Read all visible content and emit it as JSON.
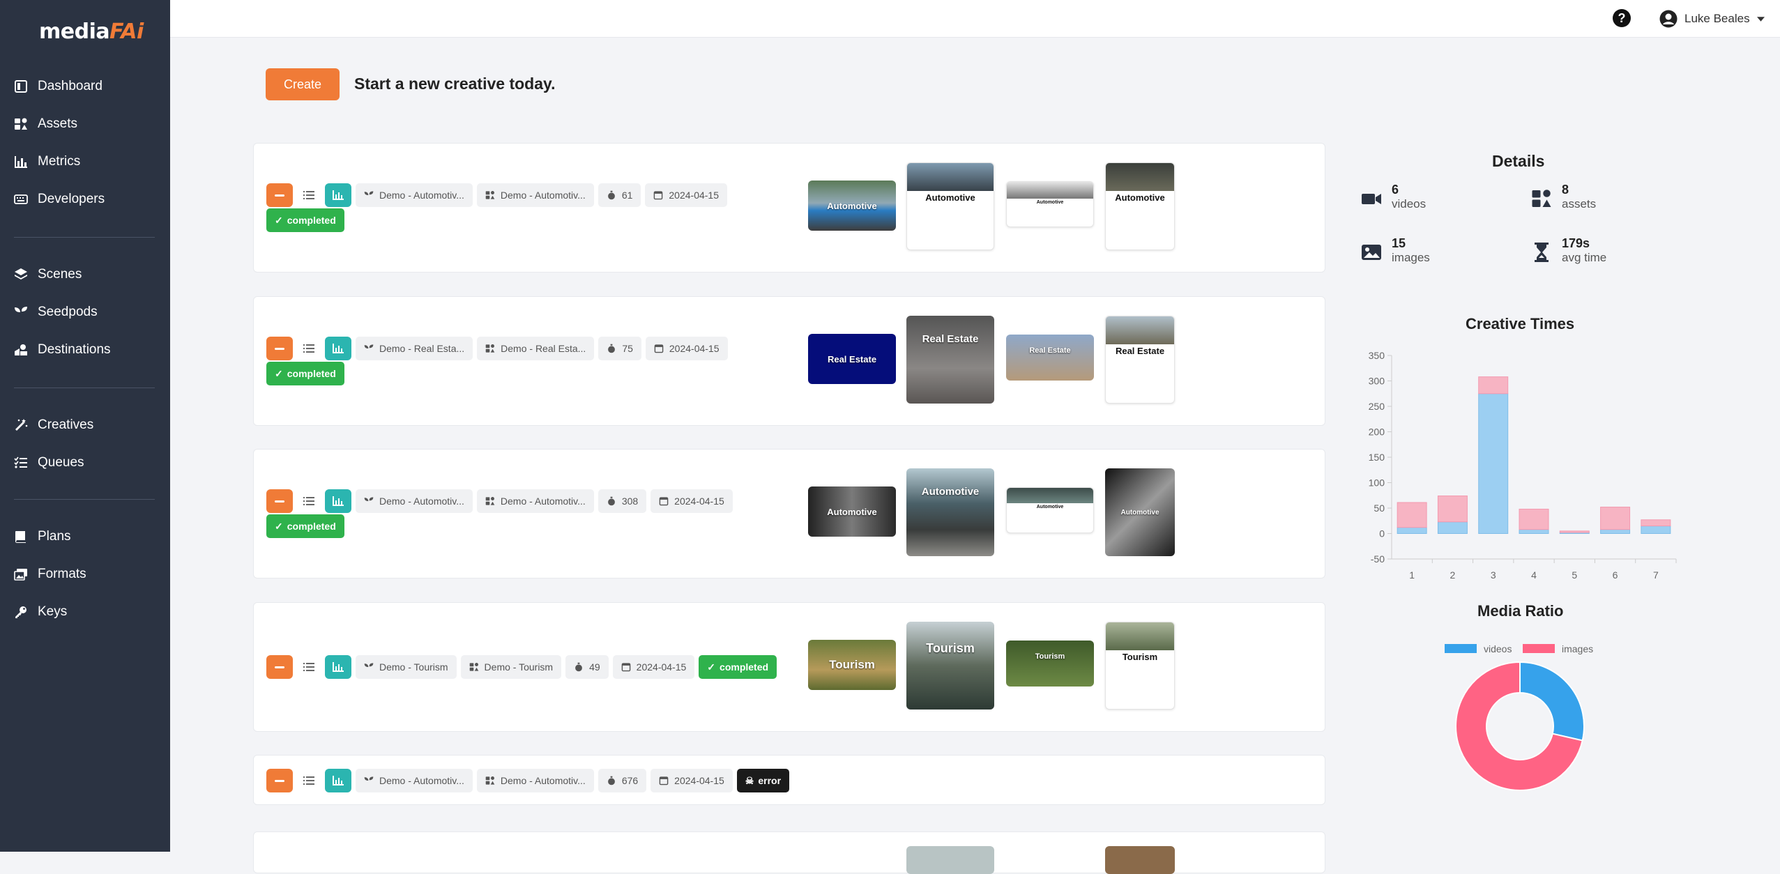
{
  "app": {
    "logo_main": "media",
    "logo_accent": "FAi"
  },
  "sidebar": {
    "items": [
      {
        "label": "Dashboard",
        "icon": "dashboard-icon"
      },
      {
        "label": "Assets",
        "icon": "assets-icon"
      },
      {
        "label": "Metrics",
        "icon": "metrics-icon"
      },
      {
        "label": "Developers",
        "icon": "keyboard-icon"
      },
      {
        "label": "Scenes",
        "icon": "layers-icon"
      },
      {
        "label": "Seedpods",
        "icon": "seedling-icon"
      },
      {
        "label": "Destinations",
        "icon": "destinations-icon"
      },
      {
        "label": "Creatives",
        "icon": "magic-wand-icon"
      },
      {
        "label": "Queues",
        "icon": "list-check-icon"
      },
      {
        "label": "Plans",
        "icon": "book-icon"
      },
      {
        "label": "Formats",
        "icon": "formats-icon"
      },
      {
        "label": "Keys",
        "icon": "key-icon"
      }
    ]
  },
  "topbar": {
    "user_name": "Luke Beales"
  },
  "create": {
    "button_label": "Create",
    "tagline": "Start a new creative today."
  },
  "creatives": [
    {
      "seedpod": "Demo - Automotiv...",
      "scene": "Demo - Automotiv...",
      "time": "61",
      "date": "2024-04-15",
      "status": "completed",
      "thumbs": [
        "Automotive",
        "Automotive",
        "Automotive",
        "Automotive"
      ]
    },
    {
      "seedpod": "Demo - Real Esta...",
      "scene": "Demo - Real Esta...",
      "time": "75",
      "date": "2024-04-15",
      "status": "completed",
      "thumbs": [
        "Real Estate",
        "Real Estate",
        "Real Estate",
        "Real Estate"
      ]
    },
    {
      "seedpod": "Demo - Automotiv...",
      "scene": "Demo - Automotiv...",
      "time": "308",
      "date": "2024-04-15",
      "status": "completed",
      "thumbs": [
        "Automotive",
        "Automotive",
        "Automotive",
        "Automotive"
      ]
    },
    {
      "seedpod": "Demo - Tourism",
      "scene": "Demo - Tourism",
      "time": "49",
      "date": "2024-04-15",
      "status": "completed",
      "thumbs": [
        "Tourism",
        "Tourism",
        "Tourism",
        "Tourism"
      ]
    },
    {
      "seedpod": "Demo - Automotiv...",
      "scene": "Demo - Automotiv...",
      "time": "676",
      "date": "2024-04-15",
      "status": "error",
      "thumbs": []
    }
  ],
  "details": {
    "title": "Details",
    "stats": [
      {
        "num": "6",
        "label": "videos",
        "icon": "video-camera-icon"
      },
      {
        "num": "8",
        "label": "assets",
        "icon": "assets-icon"
      },
      {
        "num": "15",
        "label": "images",
        "icon": "image-icon"
      },
      {
        "num": "179s",
        "label": "avg time",
        "icon": "hourglass-icon"
      }
    ]
  },
  "chart_data": [
    {
      "type": "bar",
      "title": "Creative Times",
      "categories": [
        "1",
        "2",
        "3",
        "4",
        "5",
        "6",
        "7"
      ],
      "series": [
        {
          "values": [
            12,
            23,
            275,
            8,
            2,
            8,
            15
          ],
          "color": "#9ccff2"
        },
        {
          "values": [
            49,
            51,
            33,
            40,
            3,
            44,
            12
          ],
          "color": "#f7b4c3"
        }
      ],
      "stacked": true,
      "ylim": [
        -50,
        350
      ],
      "yticks": [
        350,
        300,
        250,
        200,
        150,
        100,
        50,
        0,
        -50
      ],
      "grid": false
    },
    {
      "type": "pie",
      "title": "Media Ratio",
      "donut": true,
      "labels": [
        "videos",
        "images"
      ],
      "values": [
        6,
        15
      ],
      "colors": [
        "#36a2eb",
        "#ff6384"
      ],
      "legend": "top"
    }
  ]
}
